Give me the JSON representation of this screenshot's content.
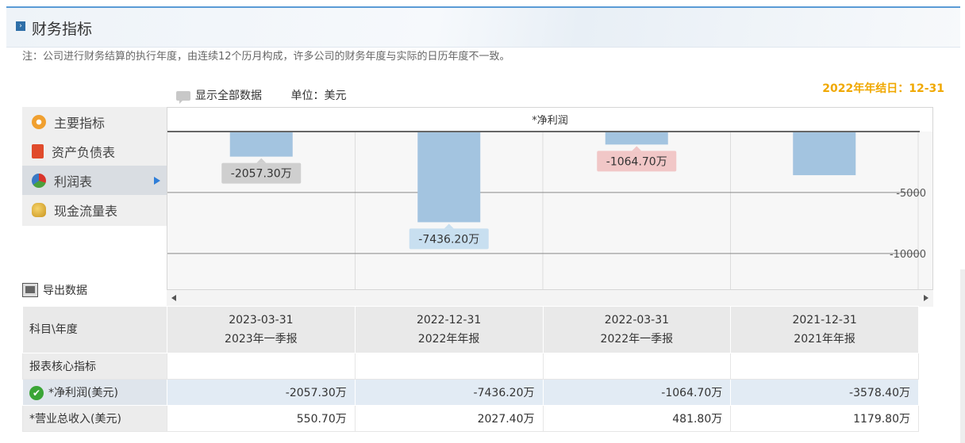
{
  "header": {
    "title": "财务指标",
    "marker": "›"
  },
  "note": "注：公司进行财务结算的执行年度，由连续12个历月构成，许多公司的财务年度与实际的日历年度不一致。",
  "year_end": "2022年年结日：12-31",
  "toolbar": {
    "show_all": "显示全部数据",
    "unit": "单位：美元"
  },
  "menu": {
    "items": [
      {
        "label": "主要指标",
        "icon": "gear-icon"
      },
      {
        "label": "资产负债表",
        "icon": "document-icon"
      },
      {
        "label": "利润表",
        "icon": "pie-chart-icon",
        "active": true
      },
      {
        "label": "现金流量表",
        "icon": "coins-icon"
      }
    ]
  },
  "export_label": "导出数据",
  "chart_data": {
    "type": "bar",
    "title": "*净利润",
    "categories": [
      "2023-03-31",
      "2022-12-31",
      "2022-03-31",
      "2021-12-31"
    ],
    "values": [
      -2057.3,
      -7436.2,
      -1064.7,
      -3578.4
    ],
    "data_labels": [
      "-2057.30万",
      "-7436.20万",
      "-1064.70万",
      ""
    ],
    "ylim": [
      -13000,
      0
    ],
    "ticks": [
      {
        "value": -5000,
        "label": "-5000"
      },
      {
        "value": -10000,
        "label": "-10000"
      }
    ],
    "grid": true,
    "bar_color": "#a3c4e0"
  },
  "table": {
    "corner": "科目\\年度",
    "columns": [
      {
        "date": "2023-03-31",
        "period": "2023年一季报"
      },
      {
        "date": "2022-12-31",
        "period": "2022年年报"
      },
      {
        "date": "2022-03-31",
        "period": "2022年一季报"
      },
      {
        "date": "2021-12-31",
        "period": "2021年年报"
      }
    ],
    "section": "报表核心指标",
    "rows": [
      {
        "label": "*净利润(美元)",
        "values": [
          "-2057.30万",
          "-7436.20万",
          "-1064.70万",
          "-3578.40万"
        ],
        "selected": true
      },
      {
        "label": "*营业总收入(美元)",
        "values": [
          "550.70万",
          "2027.40万",
          "481.80万",
          "1179.80万"
        ],
        "selected": false
      }
    ]
  }
}
